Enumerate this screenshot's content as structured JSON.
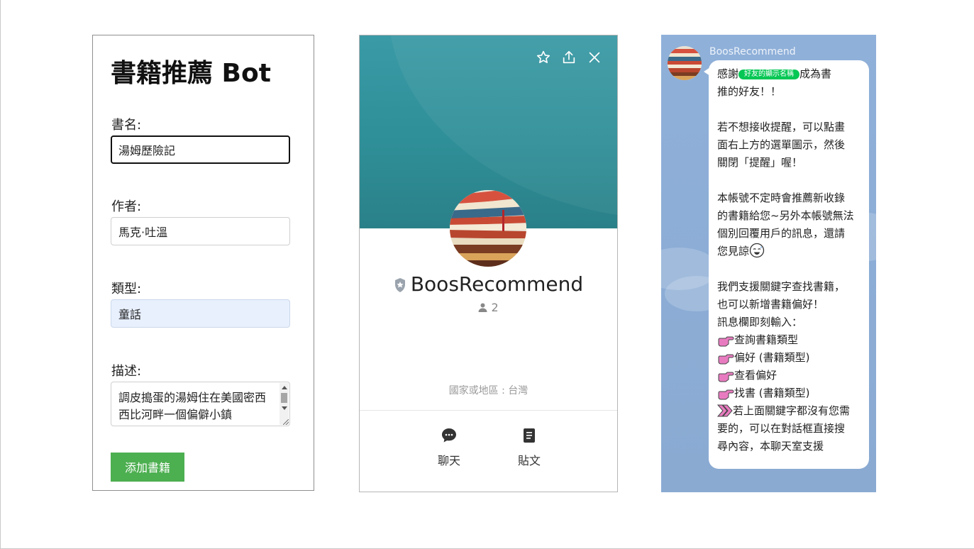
{
  "form": {
    "title": "書籍推薦 Bot",
    "book_name": {
      "label": "書名:",
      "value": "湯姆歷險記"
    },
    "author": {
      "label": "作者:",
      "value": "馬克·吐溫"
    },
    "genre": {
      "label": "類型:",
      "value": "童話"
    },
    "description": {
      "label": "描述:",
      "value": "調皮搗蛋的湯姆住在美國密西西比河畔一個偏僻小鎮"
    },
    "submit_label": "添加書籍",
    "colors": {
      "submit": "#4caf50",
      "autofill": "#e8f0fe"
    }
  },
  "profile": {
    "name": "BoosRecommend",
    "friend_count": "2",
    "country": "國家或地區 : 台灣",
    "actions": [
      {
        "label": "聊天",
        "icon": "chat-bubble-icon"
      },
      {
        "label": "貼文",
        "icon": "post-document-icon"
      }
    ],
    "top_icons": [
      "star-icon",
      "share-icon",
      "close-icon"
    ],
    "colors": {
      "cover": "#3a9aa6"
    }
  },
  "chat": {
    "sender": "BoosRecommend",
    "greeting_prefix": "感謝",
    "display_name_tag": "好友的顯示名稱",
    "greeting_suffix": "成為書",
    "line_2": "推的好友！！",
    "line_4": "若不想接收提醒，可以點畫",
    "line_5": "面右上方的選單圖示，然後",
    "line_6": "關閉「提醒」喔！",
    "line_8": "本帳號不定時會推薦新收錄",
    "line_9": "的書籍給您~另外本帳號無法",
    "line_10": "個別回覆用戶的訊息，還請",
    "line_11": "您見諒",
    "line_13": "我們支援關鍵字查找書籍，",
    "line_14": "也可以新增書籍偏好！",
    "line_15": "訊息欄即刻輸入：",
    "commands": [
      "查詢書籍類型",
      "偏好 (書籍類型)",
      "查看偏好",
      "找書 (書籍類型)"
    ],
    "line_20": "若上面關鍵字都沒有您需",
    "line_21": "要的，可以在對話框直接搜",
    "line_22": "尋內容，本聊天室支援",
    "colors": {
      "background": "#8fb0d9",
      "tag": "#06c755",
      "pointer": "#e87bc0"
    }
  }
}
